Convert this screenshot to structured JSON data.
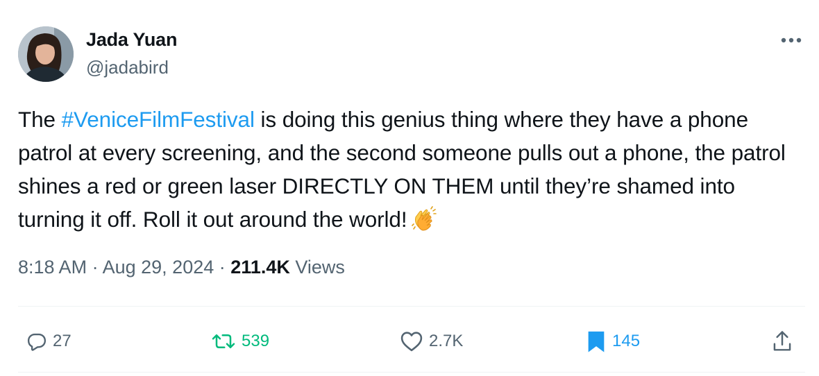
{
  "author": {
    "display_name": "Jada Yuan",
    "handle": "@jadabird"
  },
  "tweet": {
    "text_before": "The ",
    "hashtag": "#VeniceFilmFestival",
    "text_after": " is doing this genius thing where they have a phone patrol at every screening, and the second someone pulls out a phone, the patrol shines a red or green laser DIRECTLY ON THEM until they’re shamed into turning it off. Roll it out around the world!",
    "emoji": "clapping-hands"
  },
  "meta": {
    "time": "8:18 AM",
    "separator": "·",
    "date": "Aug 29, 2024",
    "views_count": "211.4K",
    "views_label": "Views"
  },
  "actions": {
    "replies": "27",
    "retweets": "539",
    "likes": "2.7K",
    "bookmarks": "145"
  },
  "colors": {
    "link": "#1d9bf0",
    "retweet_active": "#00ba7c",
    "secondary_text": "#536471"
  }
}
